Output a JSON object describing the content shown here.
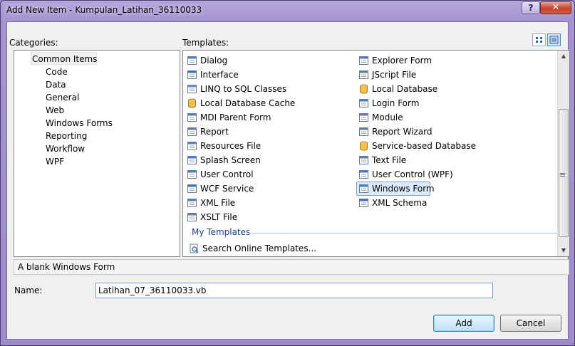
{
  "window": {
    "title": "Add New Item - Kumpulan_Latihan_36110033",
    "help_label": "?",
    "close_label": "✕"
  },
  "categories": {
    "label": "Categories:",
    "items": [
      {
        "label": "Common Items",
        "level": 0,
        "selected": true
      },
      {
        "label": "Code",
        "level": 1
      },
      {
        "label": "Data",
        "level": 1
      },
      {
        "label": "General",
        "level": 1
      },
      {
        "label": "Web",
        "level": 1
      },
      {
        "label": "Windows Forms",
        "level": 1
      },
      {
        "label": "Reporting",
        "level": 1
      },
      {
        "label": "Workflow",
        "level": 1
      },
      {
        "label": "WPF",
        "level": 1
      }
    ]
  },
  "templates": {
    "label": "Templates:",
    "left_column": [
      {
        "label": "Dialog",
        "icon": "dialog-icon"
      },
      {
        "label": "Interface",
        "icon": "interface-icon"
      },
      {
        "label": "LINQ to SQL Classes",
        "icon": "linq-icon"
      },
      {
        "label": "Local Database Cache",
        "icon": "database-cache-icon"
      },
      {
        "label": "MDI Parent Form",
        "icon": "mdi-form-icon"
      },
      {
        "label": "Report",
        "icon": "report-icon"
      },
      {
        "label": "Resources File",
        "icon": "resources-icon"
      },
      {
        "label": "Splash Screen",
        "icon": "splash-icon"
      },
      {
        "label": "User Control",
        "icon": "user-control-icon"
      },
      {
        "label": "WCF Service",
        "icon": "wcf-icon"
      },
      {
        "label": "XML File",
        "icon": "xml-file-icon"
      },
      {
        "label": "XSLT File",
        "icon": "xslt-icon"
      }
    ],
    "right_column": [
      {
        "label": "Explorer Form",
        "icon": "explorer-form-icon"
      },
      {
        "label": "JScript File",
        "icon": "jscript-icon"
      },
      {
        "label": "Local Database",
        "icon": "database-icon"
      },
      {
        "label": "Login Form",
        "icon": "login-form-icon"
      },
      {
        "label": "Module",
        "icon": "module-icon"
      },
      {
        "label": "Report Wizard",
        "icon": "report-wizard-icon"
      },
      {
        "label": "Service-based Database",
        "icon": "service-db-icon"
      },
      {
        "label": "Text File",
        "icon": "text-file-icon"
      },
      {
        "label": "User Control (WPF)",
        "icon": "wpf-control-icon"
      },
      {
        "label": "Windows Form",
        "icon": "windows-form-icon",
        "selected": true
      },
      {
        "label": "XML Schema",
        "icon": "xml-schema-icon"
      }
    ],
    "my_templates_label": "My Templates",
    "search_online_label": "Search Online Templates..."
  },
  "description": "A blank Windows Form",
  "name_field": {
    "label": "Name:",
    "value": "Latihan_07_36110033.vb"
  },
  "buttons": {
    "add": "Add",
    "cancel": "Cancel"
  },
  "colors": {
    "selection_bg": "#dcebfc",
    "selection_border": "#7da2ce",
    "my_templates_text": "#1e3f8e"
  }
}
